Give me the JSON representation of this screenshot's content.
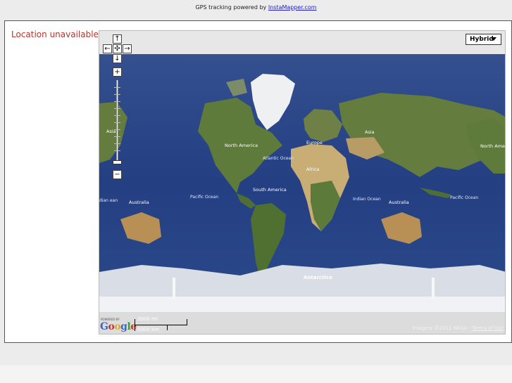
{
  "header": {
    "prefix": "GPS tracking powered by",
    "link_text": "InstaMapper.com"
  },
  "status_text": "Location unavailable",
  "map": {
    "type_selector": "Hybrid",
    "zoom_in": "+",
    "zoom_out": "−",
    "pan_up": "↑",
    "pan_down": "↓",
    "pan_left": "←",
    "pan_right": "→",
    "pan_center": "✣",
    "powered_by": "POWERED BY",
    "logo": "Google",
    "scale_mi": "3000 mi",
    "scale_km": "5000 km",
    "copyright_prefix": "Imagery ©2011 NASA -",
    "terms_link": "Terms of Use",
    "labels": {
      "asia_left": "Asia",
      "north_america": "North America",
      "atlantic_ocean": "Atlantic Ocean",
      "europe": "Europe",
      "asia_right": "Asia",
      "africa": "Africa",
      "north_america_right": "North America",
      "south_america": "South America",
      "australia_left": "Australia",
      "pacific_left": "Pacific Ocean",
      "indian_ocean": "Indian Ocean",
      "australia_right": "Australia",
      "pacific_right": "Pacific Ocean",
      "antarctica": "Antarctica",
      "dian_ean": "dian ean"
    }
  },
  "colors": {
    "ocean": "#2c4a8c",
    "deep_ocean": "#1d3370",
    "land": "#5c7a3a",
    "desert": "#c8ad74",
    "ice": "#e8eaf0",
    "status_red": "#b5352a"
  }
}
